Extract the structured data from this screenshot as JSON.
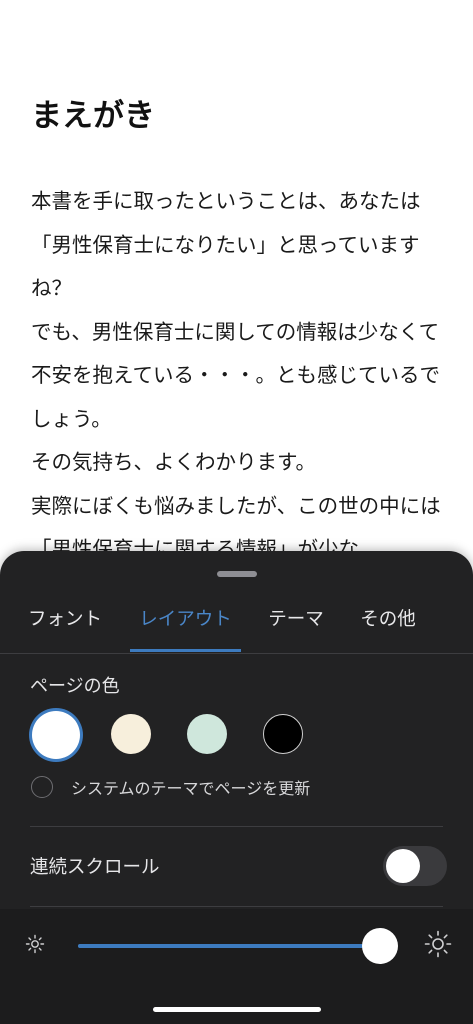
{
  "book": {
    "heading": "まえがき",
    "paragraphs": [
      "本書を手に取ったということは、あなたは「男性保育士になりたい」と思っていますね？",
      "でも、男性保育士に関しての情報は少なくて不安を抱えている・・・。とも感じているでしょう。",
      "その気持ち、よくわかります。",
      "実際にぼくも悩みましたが、この世の中には「男性保育士に関する情報」が少な"
    ]
  },
  "settings": {
    "tabs": [
      {
        "label": "フォント",
        "active": false
      },
      {
        "label": "レイアウト",
        "active": true
      },
      {
        "label": "テーマ",
        "active": false
      },
      {
        "label": "その他",
        "active": false
      }
    ],
    "page_color": {
      "title": "ページの色",
      "swatches": [
        {
          "name": "white",
          "color": "#ffffff",
          "selected": true
        },
        {
          "name": "sepia",
          "color": "#f7efdc",
          "selected": false
        },
        {
          "name": "mint",
          "color": "#cfe7dc",
          "selected": false
        },
        {
          "name": "black",
          "color": "#000000",
          "selected": false
        }
      ],
      "system_theme_label": "システムのテーマでページを更新",
      "system_theme_checked": false
    },
    "continuous_scroll": {
      "label": "連続スクロール",
      "enabled": false
    },
    "brightness": {
      "value": 1.0,
      "min_icon": "sun-small-icon",
      "max_icon": "sun-large-icon"
    }
  },
  "colors": {
    "accent": "#3d7bbf",
    "sheet_bg": "#222223"
  }
}
